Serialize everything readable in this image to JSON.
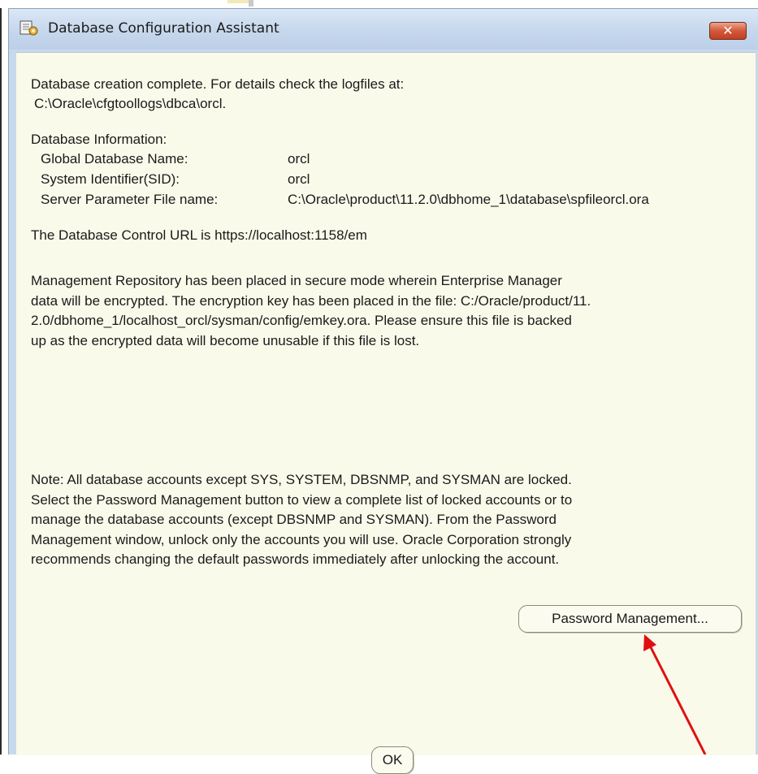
{
  "window": {
    "title": "Database Configuration Assistant",
    "close_glyph": "✕",
    "icon": "dbca-icon"
  },
  "message": {
    "creation_line1": "Database creation complete. For details check the logfiles at:",
    "creation_line2": "C:\\Oracle\\cfgtoollogs\\dbca\\orcl.",
    "db_info_heading": "Database Information:",
    "db_info": [
      {
        "label": "Global Database Name:",
        "value": "orcl"
      },
      {
        "label": "System Identifier(SID):",
        "value": "orcl"
      },
      {
        "label": "Server Parameter File name:",
        "value": "C:\\Oracle\\product\\11.2.0\\dbhome_1\\database\\spfileorcl.ora"
      }
    ],
    "control_url": "The Database Control URL is https://localhost:1158/em",
    "repository_lines": [
      "Management Repository has been placed in secure mode wherein Enterprise Manager",
      "data will be encrypted.  The encryption key has been placed in the file: C:/Oracle/product/11.",
      "2.0/dbhome_1/localhost_orcl/sysman/config/emkey.ora.   Please ensure this file is backed",
      "up as the encrypted data will become unusable if this file is lost."
    ],
    "note_lines": [
      "Note: All database accounts except SYS, SYSTEM, DBSNMP, and SYSMAN are locked.",
      "Select the Password Management button to view a complete list of locked accounts or to",
      "manage the database accounts (except DBSNMP and SYSMAN). From the Password",
      "Management window, unlock only the accounts you will use. Oracle Corporation strongly",
      "recommends changing the default passwords immediately after unlocking the account."
    ]
  },
  "buttons": {
    "password_management": "Password Management...",
    "ok": "OK"
  },
  "colors": {
    "content_bg": "#fafaeb",
    "titlebar": "#c6d7ec",
    "close": "#c23f24",
    "annotation_arrow": "#e01010"
  }
}
